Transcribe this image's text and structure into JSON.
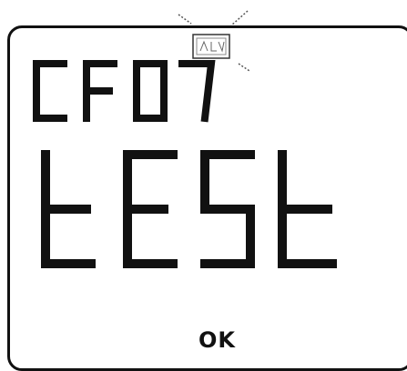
{
  "display": {
    "code": "CF07",
    "mode": "tESt",
    "confirm_label": "OK",
    "indicator_icon": "blinking-indicator-icon",
    "indicator_state": "blinking"
  },
  "colors": {
    "segment": "#111111",
    "frame": "#111111",
    "background": "#ffffff"
  }
}
